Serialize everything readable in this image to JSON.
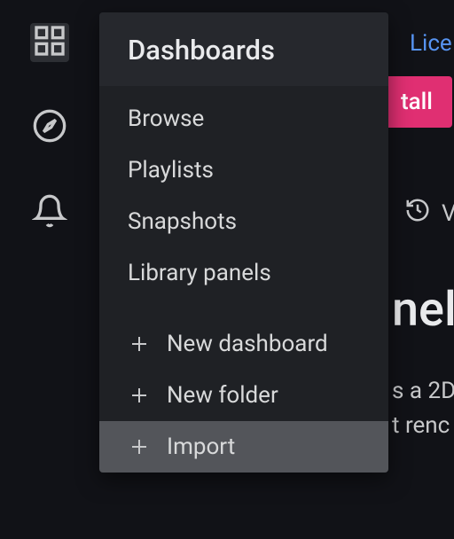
{
  "sidebar": {
    "icons": [
      "dashboards",
      "explore",
      "alerting"
    ]
  },
  "flyout": {
    "title": "Dashboards",
    "links": [
      "Browse",
      "Playlists",
      "Snapshots",
      "Library panels"
    ],
    "actions": [
      "New dashboard",
      "New folder",
      "Import"
    ]
  },
  "background": {
    "link": "Lice",
    "button": "tall",
    "history_letter": "V",
    "heading": "nel",
    "desc_line1": "s a 2D",
    "desc_line2": "t renc"
  }
}
